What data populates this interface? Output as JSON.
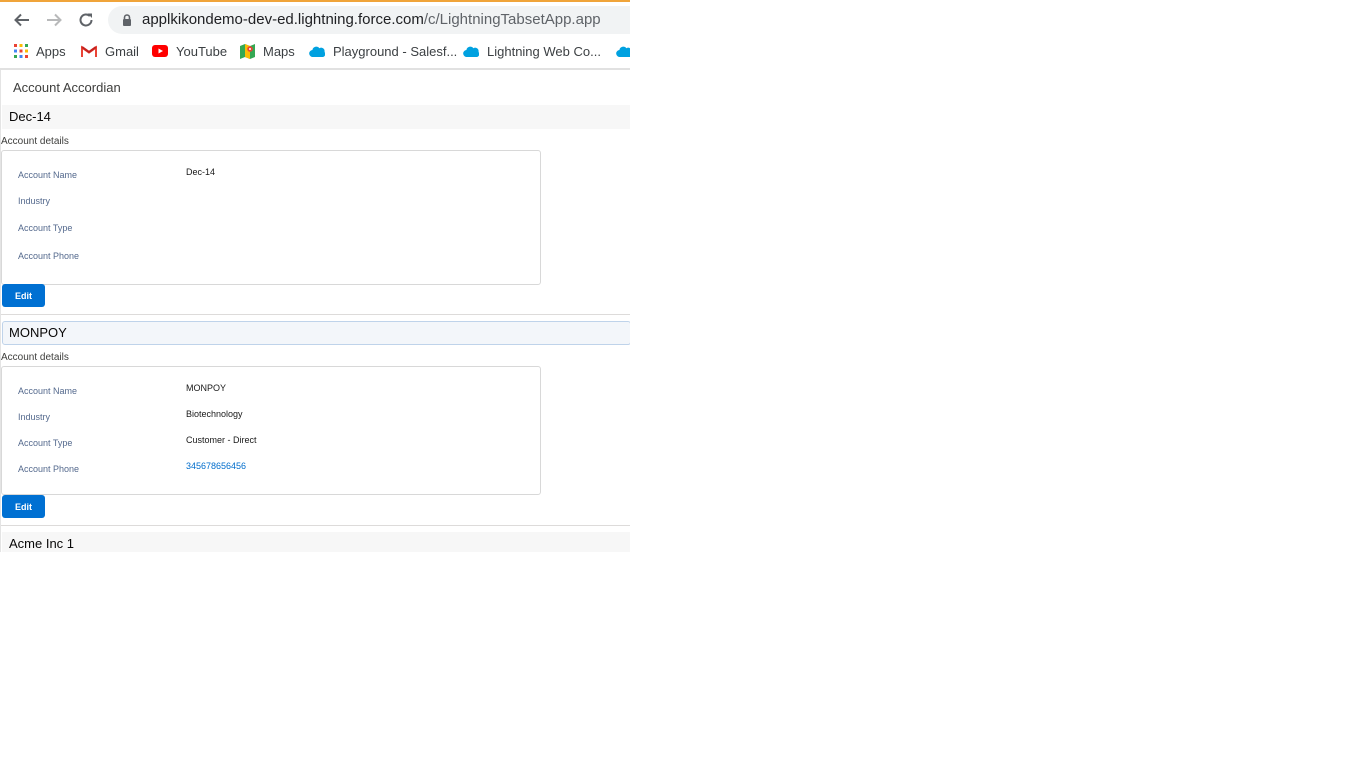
{
  "browser": {
    "url_host": "applkikondemo-dev-ed.lightning.force.com",
    "url_path": "/c/LightningTabsetApp.app",
    "bookmarks": [
      {
        "label": "Apps",
        "icon": "apps-grid-icon"
      },
      {
        "label": "Gmail",
        "icon": "gmail-icon"
      },
      {
        "label": "YouTube",
        "icon": "youtube-icon"
      },
      {
        "label": "Maps",
        "icon": "maps-icon"
      },
      {
        "label": "Playground - Salesf...",
        "icon": "salesforce-cloud-icon"
      },
      {
        "label": "Lightning Web Co...",
        "icon": "salesforce-cloud-icon"
      }
    ]
  },
  "page": {
    "title": "Account Accordian"
  },
  "accounts": [
    {
      "name": "Dec-14",
      "details_label": "Account details",
      "fields": [
        {
          "label": "Account Name",
          "value": "Dec-14"
        },
        {
          "label": "Industry",
          "value": ""
        },
        {
          "label": "Account Type",
          "value": ""
        },
        {
          "label": "Account Phone",
          "value": ""
        }
      ],
      "edit_label": "Edit"
    },
    {
      "name": "MONPOY",
      "details_label": "Account details",
      "fields": [
        {
          "label": "Account Name",
          "value": "MONPOY"
        },
        {
          "label": "Industry",
          "value": "Biotechnology"
        },
        {
          "label": "Account Type",
          "value": "Customer - Direct"
        },
        {
          "label": "Account Phone",
          "value": "345678656456"
        }
      ],
      "edit_label": "Edit"
    },
    {
      "name": "Acme Inc 1"
    }
  ],
  "colors": {
    "brand_button": "#0070d2",
    "link": "#006dcc",
    "tab_accent": "#f0a43a"
  }
}
